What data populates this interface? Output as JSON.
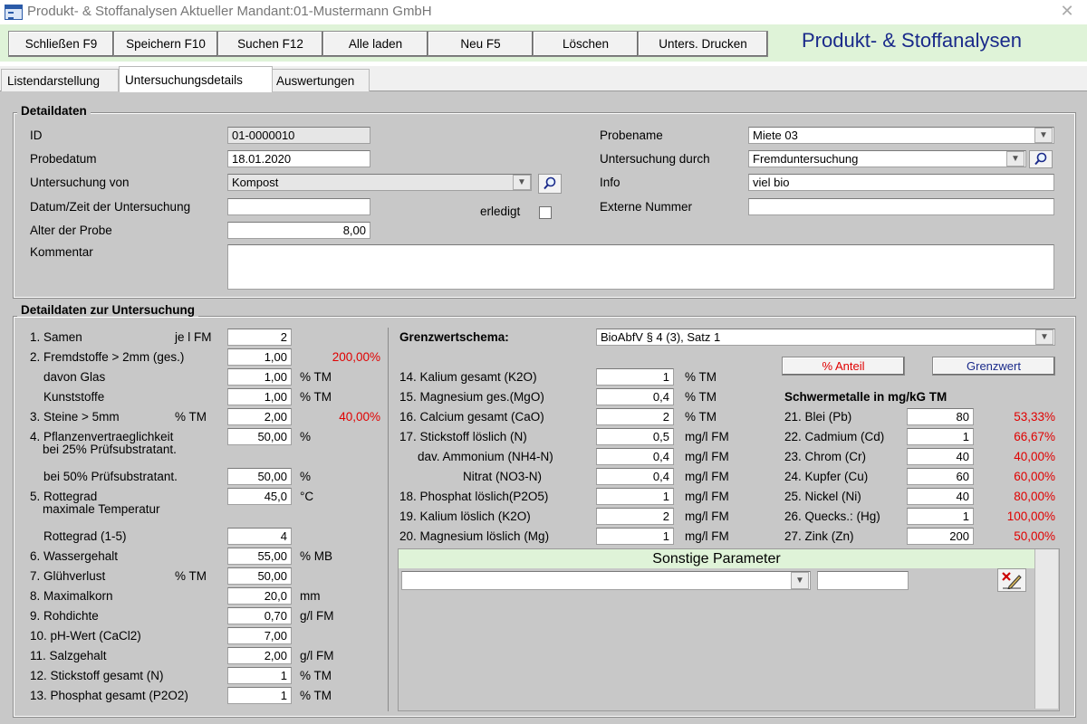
{
  "window": {
    "title": "Produkt- & Stoffanalysen Aktueller Mandant:01-Mustermann GmbH",
    "close": "✕"
  },
  "toolbar": {
    "buttons": [
      "Schließen F9",
      "Speichern F10",
      "Suchen F12",
      "Alle laden",
      "Neu F5",
      "Löschen",
      "Unters. Drucken"
    ],
    "heading": "Produkt- & Stoffanalysen"
  },
  "tabs": [
    "Listendarstellung",
    "Untersuchungsdetails",
    "Auswertungen"
  ],
  "detail": {
    "title": "Detaildaten",
    "id_label": "ID",
    "id_value": "01-0000010",
    "probedatum_label": "Probedatum",
    "probedatum_value": "18.01.2020",
    "untersuchung_von_label": "Untersuchung von",
    "untersuchung_von_value": "Kompost",
    "datum_zeit_label": "Datum/Zeit der Untersuchung",
    "datum_zeit_value": "",
    "erledigt_label": "erledigt",
    "alter_label": "Alter der Probe",
    "alter_value": "8,00",
    "kommentar_label": "Kommentar",
    "kommentar_value": "",
    "probename_label": "Probename",
    "probename_value": "Miete 03",
    "untersuchung_durch_label": "Untersuchung durch",
    "untersuchung_durch_value": "Fremduntersuchung",
    "info_label": "Info",
    "info_value": "viel bio",
    "externe_label": "Externe Nummer",
    "externe_value": ""
  },
  "untersuchung": {
    "title": "Detaildaten zur Untersuchung",
    "left": [
      {
        "label": "1. Samen",
        "sub": "je l FM",
        "value": "2",
        "unit": "",
        "pct": ""
      },
      {
        "label": "2. Fremdstoffe > 2mm (ges.)",
        "sub": "",
        "value": "1,00",
        "unit": "",
        "pct": "200,00%"
      },
      {
        "label": "davon Glas",
        "sub": "",
        "value": "1,00",
        "unit": "% TM",
        "pct": ""
      },
      {
        "label": "Kunststoffe",
        "sub": "",
        "value": "1,00",
        "unit": "% TM",
        "pct": ""
      },
      {
        "label": "3. Steine > 5mm",
        "sub": "% TM",
        "value": "2,00",
        "unit": "",
        "pct": "40,00%"
      },
      {
        "label": "4. Pflanzenvertraeglichkeit",
        "label2": "bei 25% Prüfsubstratant.",
        "sub": "",
        "value": "50,00",
        "unit": "%",
        "pct": ""
      },
      {
        "label": "bei 50% Prüfsubstratant.",
        "sub": "",
        "value": "50,00",
        "unit": "%",
        "pct": ""
      },
      {
        "label": "5. Rottegrad",
        "label2": "maximale Temperatur",
        "sub": "",
        "value": "45,0",
        "unit": "°C",
        "pct": ""
      },
      {
        "label": "Rottegrad (1-5)",
        "sub": "",
        "value": "4",
        "unit": "",
        "pct": ""
      },
      {
        "label": "6. Wassergehalt",
        "sub": "",
        "value": "55,00",
        "unit": "% MB",
        "pct": ""
      },
      {
        "label": "7. Glühverlust",
        "sub": "% TM",
        "value": "50,00",
        "unit": "",
        "pct": ""
      },
      {
        "label": "8. Maximalkorn",
        "sub": "",
        "value": "20,0",
        "unit": "mm",
        "pct": ""
      },
      {
        "label": "9. Rohdichte",
        "sub": "",
        "value": "0,70",
        "unit": "g/l FM",
        "pct": ""
      },
      {
        "label": "10. pH-Wert (CaCl2)",
        "sub": "",
        "value": "7,00",
        "unit": "",
        "pct": ""
      },
      {
        "label": "11. Salzgehalt",
        "sub": "",
        "value": "2,00",
        "unit": "g/l FM",
        "pct": ""
      },
      {
        "label": "12. Stickstoff gesamt (N)",
        "sub": "",
        "value": "1",
        "unit": "% TM",
        "pct": ""
      },
      {
        "label": "13. Phosphat gesamt (P2O2)",
        "sub": "",
        "value": "1",
        "unit": "% TM",
        "pct": ""
      }
    ],
    "grenzwert_label": "Grenzwertschema:",
    "grenzwert_value": "BioAbfV § 4 (3), Satz 1",
    "btn_anteil": "% Anteil",
    "btn_grenzwert": "Grenzwert",
    "schwermetalle_title": "Schwermetalle in mg/kG TM",
    "mid": [
      {
        "label": "14. Kalium gesamt  (K2O)",
        "value": "1",
        "unit": "% TM"
      },
      {
        "label": "15. Magnesium ges.(MgO)",
        "value": "0,4",
        "unit": "% TM"
      },
      {
        "label": "16. Calcium gesamt (CaO)",
        "value": "2",
        "unit": "% TM"
      },
      {
        "label": "17. Stickstoff löslich (N)",
        "value": "0,5",
        "unit": "mg/l FM"
      },
      {
        "label": "dav. Ammonium (NH4-N)",
        "value": "0,4",
        "unit": "mg/l FM"
      },
      {
        "label": "Nitrat (NO3-N)",
        "value": "0,4",
        "unit": "mg/l FM"
      },
      {
        "label": "18. Phosphat löslich(P2O5)",
        "value": "1",
        "unit": "mg/l FM"
      },
      {
        "label": "19. Kalium löslich   (K2O)",
        "value": "2",
        "unit": "mg/l FM"
      },
      {
        "label": "20. Magnesium löslich (Mg)",
        "value": "1",
        "unit": "mg/l FM"
      }
    ],
    "metals": [
      {
        "label": "21. Blei (Pb)",
        "value": "80",
        "pct": "53,33%"
      },
      {
        "label": "22. Cadmium (Cd)",
        "value": "1",
        "pct": "66,67%"
      },
      {
        "label": "23. Chrom (Cr)",
        "value": "40",
        "pct": "40,00%"
      },
      {
        "label": "24. Kupfer (Cu)",
        "value": "60",
        "pct": "60,00%"
      },
      {
        "label": "25. Nickel (Ni)",
        "value": "40",
        "pct": "80,00%"
      },
      {
        "label": "26. Quecks.: (Hg)",
        "value": "1",
        "pct": "100,00%"
      },
      {
        "label": "27. Zink (Zn)",
        "value": "200",
        "pct": "50,00%"
      }
    ],
    "sonstige_title": "Sonstige Parameter",
    "sonstige_combo": "",
    "sonstige_value": ""
  },
  "icons": {
    "search": "search-icon",
    "dropdown": "chevron-down-icon",
    "delete_edit": "delete-edit-icon"
  },
  "colors": {
    "toolbar_bg": "#dff3d8",
    "heading": "#1a2a8a",
    "pct_red": "#e00000",
    "panel": "#c8c8c8"
  }
}
